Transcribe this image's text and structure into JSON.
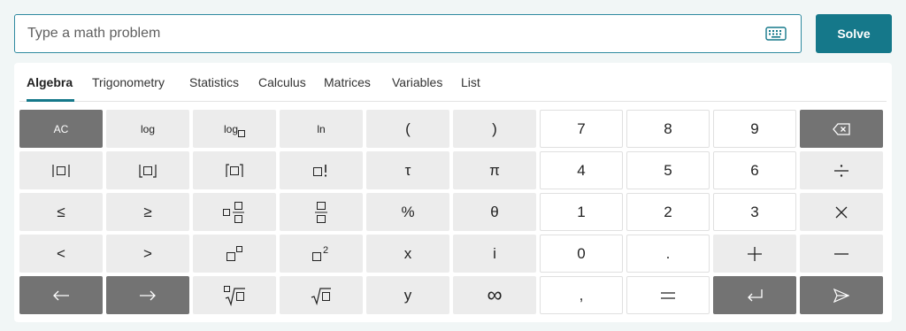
{
  "search": {
    "placeholder": "Type a math problem"
  },
  "solve_label": "Solve",
  "tabs": [
    {
      "label": "Algebra",
      "active": true
    },
    {
      "label": "Trigonometry"
    },
    {
      "label": "Statistics"
    },
    {
      "label": "Calculus"
    },
    {
      "label": "Matrices"
    },
    {
      "label": "Variables"
    },
    {
      "label": "List"
    }
  ],
  "keys": {
    "ac": "AC",
    "log": "log",
    "log_base": "log",
    "ln": "ln",
    "lparen": "(",
    "rparen": ")",
    "tau": "τ",
    "pi": "π",
    "percent": "%",
    "theta": "θ",
    "leq": "≤",
    "geq": "≥",
    "lt": "<",
    "gt": ">",
    "x": "x",
    "i": "i",
    "y": "y",
    "infinity": "∞",
    "comma": ",",
    "decimal": ".",
    "d0": "0",
    "d1": "1",
    "d2": "2",
    "d3": "3",
    "d4": "4",
    "d5": "5",
    "d6": "6",
    "d7": "7",
    "d8": "8",
    "d9": "9"
  },
  "colors": {
    "accent": "#15788a",
    "dark_key": "#737373",
    "light_key": "#ececec"
  }
}
